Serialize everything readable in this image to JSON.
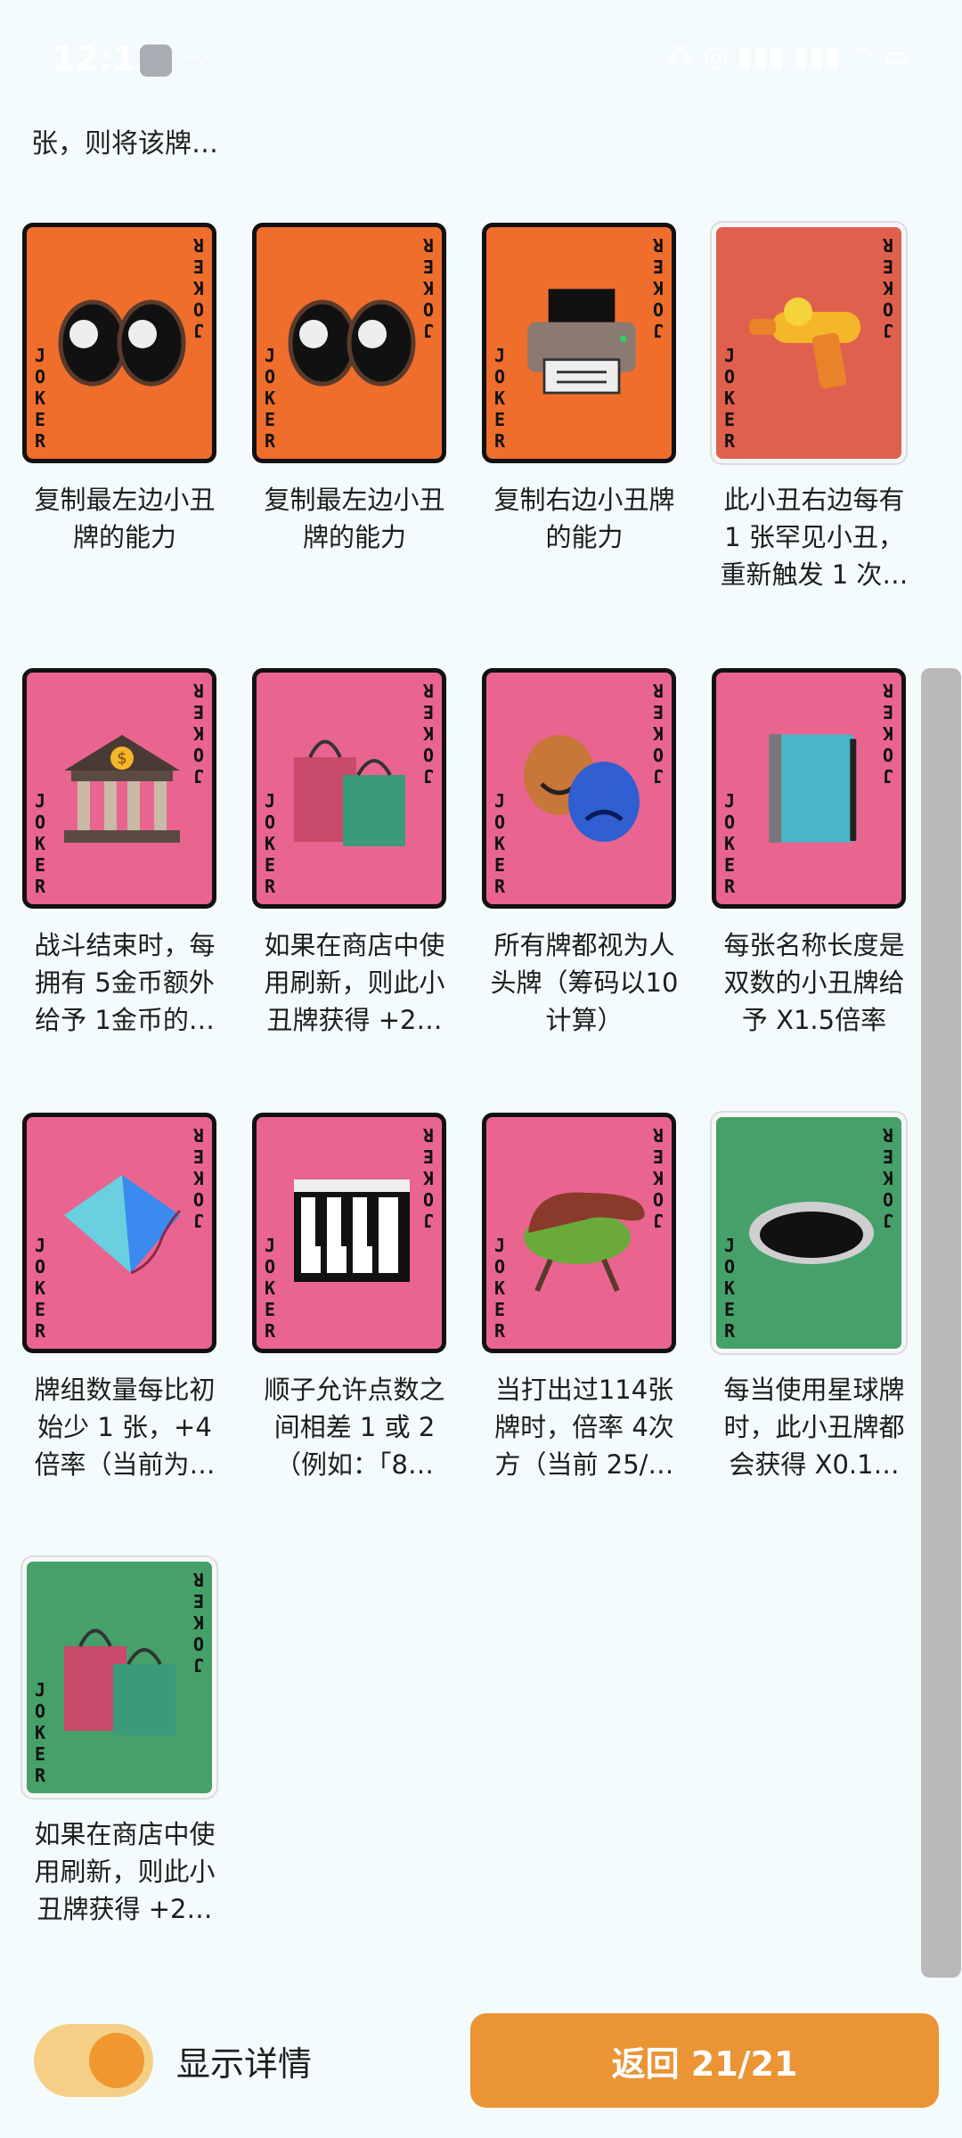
{
  "status_bar": {
    "time": "12:15",
    "extra": "···",
    "right": "⁂ ◎ ▮▮▮ ▮▮▮ ◠ ▭"
  },
  "top_text": "张，则将该牌…",
  "card_word": "JOKER",
  "colors": {
    "orange": "#ef6e2c",
    "red": "#e0604e",
    "pink": "#e9658f",
    "green": "#46a06a",
    "accent": "#ea9434"
  },
  "tiles": [
    {
      "name": "eyes",
      "bg": "orange",
      "icon": "eyes-icon",
      "lines": [
        "复制最左边小丑",
        "牌的能力"
      ]
    },
    {
      "name": "eyes-2",
      "bg": "orange",
      "icon": "eyes-icon",
      "lines": [
        "复制最左边小丑",
        "牌的能力"
      ]
    },
    {
      "name": "printer",
      "bg": "orange",
      "icon": "printer-icon",
      "lines": [
        "复制右边小丑牌",
        "的能力"
      ]
    },
    {
      "name": "water-gun",
      "bg": "red",
      "icon": "water-gun-icon",
      "light": true,
      "lines": [
        "此小丑右边每有",
        "1 张罕见小丑，",
        "重新触发 1 次…"
      ]
    },
    {
      "name": "bank",
      "bg": "pink",
      "icon": "bank-icon",
      "lines": [
        "战斗结束时，每",
        "拥有 5金币额外",
        "给予 1金币的…"
      ]
    },
    {
      "name": "shopping",
      "bg": "pink",
      "icon": "shopping-bags-icon",
      "lines": [
        "如果在商店中使",
        "用刷新，则此小",
        "丑牌获得 +2…"
      ]
    },
    {
      "name": "masks",
      "bg": "pink",
      "icon": "theater-masks-icon",
      "lines": [
        "所有牌都视为人",
        "头牌（筹码以10",
        "计算）"
      ]
    },
    {
      "name": "book",
      "bg": "pink",
      "icon": "book-icon",
      "lines": [
        "每张名称长度是",
        "双数的小丑牌给",
        "予 X1.5倍率"
      ]
    },
    {
      "name": "kite",
      "bg": "pink",
      "icon": "kite-icon",
      "lines": [
        "牌组数量每比初",
        "始少 1 张，+4",
        "倍率（当前为…"
      ]
    },
    {
      "name": "piano",
      "bg": "pink",
      "icon": "piano-icon",
      "lines": [
        "顺子允许点数之",
        "间相差 1 或 2",
        "（例如：「8…"
      ]
    },
    {
      "name": "grill",
      "bg": "pink",
      "icon": "grill-icon",
      "lines": [
        "当打出过114张",
        "牌时，倍率 4次",
        "方（当前 25/…"
      ]
    },
    {
      "name": "hole",
      "bg": "green",
      "icon": "hole-icon",
      "light": true,
      "lines": [
        "每当使用星球牌",
        "时，此小丑牌都",
        "会获得 X0.1…"
      ]
    },
    {
      "name": "shopping-green",
      "bg": "green",
      "icon": "shopping-bags-icon",
      "light": true,
      "lines": [
        "如果在商店中使",
        "用刷新，则此小",
        "丑牌获得 +2…"
      ]
    }
  ],
  "bottom": {
    "toggle_label": "显示详情",
    "back_label": "返回 21/21"
  }
}
